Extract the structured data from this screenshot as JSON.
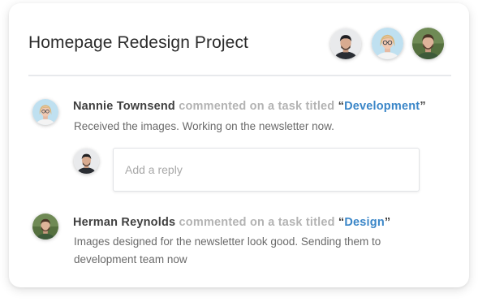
{
  "project": {
    "title": "Homepage Redesign Project",
    "members": [
      {
        "name": "member-man-dark-hair"
      },
      {
        "name": "member-woman-glasses"
      },
      {
        "name": "member-man-beard"
      }
    ]
  },
  "activity": [
    {
      "author": "Nannie Townsend",
      "action": "commented on a task titled",
      "open_quote": "“",
      "task": "Development",
      "close_quote": "”",
      "message": "Received the images. Working on the newsletter now."
    },
    {
      "author": "Herman Reynolds",
      "action": "commented on a task titled",
      "open_quote": "“",
      "task": "Design",
      "close_quote": "”",
      "message": "Images designed for the newsletter look good. Sending them to development team now"
    }
  ],
  "reply": {
    "placeholder": "Add a reply",
    "value": ""
  },
  "colors": {
    "link": "#3a86c8",
    "author": "#3f3f3f",
    "muted": "#b3b3b3"
  }
}
